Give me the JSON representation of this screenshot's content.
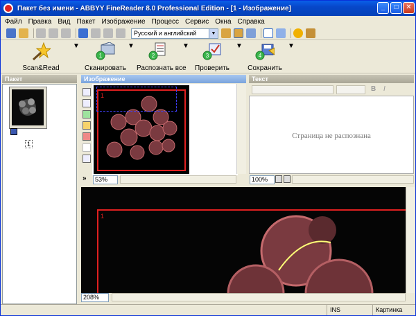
{
  "window": {
    "title": "Пакет без имени - ABBYY FineReader 8.0 Professional Edition - [1 - Изображение]"
  },
  "menu": [
    "Файл",
    "Правка",
    "Вид",
    "Пакет",
    "Изображение",
    "Процесс",
    "Сервис",
    "Окна",
    "Справка"
  ],
  "toolbar": {
    "language": "Русский и английский"
  },
  "big_buttons": [
    {
      "label": "Scan&Read",
      "icon": "star-wand-icon"
    },
    {
      "label": "Сканировать",
      "icon": "scanner-icon",
      "step": "1"
    },
    {
      "label": "Распознать все",
      "icon": "recognize-icon",
      "step": "2"
    },
    {
      "label": "Проверить",
      "icon": "check-icon",
      "step": "3"
    },
    {
      "label": "Сохранить",
      "icon": "save-icon",
      "step": "4"
    }
  ],
  "panels": {
    "batch": {
      "title": "Пакет",
      "page_number": "1"
    },
    "image": {
      "title": "Изображение",
      "zoom": "53%",
      "block_number": "1"
    },
    "text": {
      "title": "Текст",
      "empty": "Страница не распознана",
      "zoom": "100%"
    },
    "zoom": {
      "zoom": "208%",
      "block_number": "1"
    }
  },
  "status": {
    "ins": "INS",
    "mode": "Картинка"
  },
  "colors": {
    "title": "#0a5fe8",
    "block_frame": "#e02020"
  }
}
